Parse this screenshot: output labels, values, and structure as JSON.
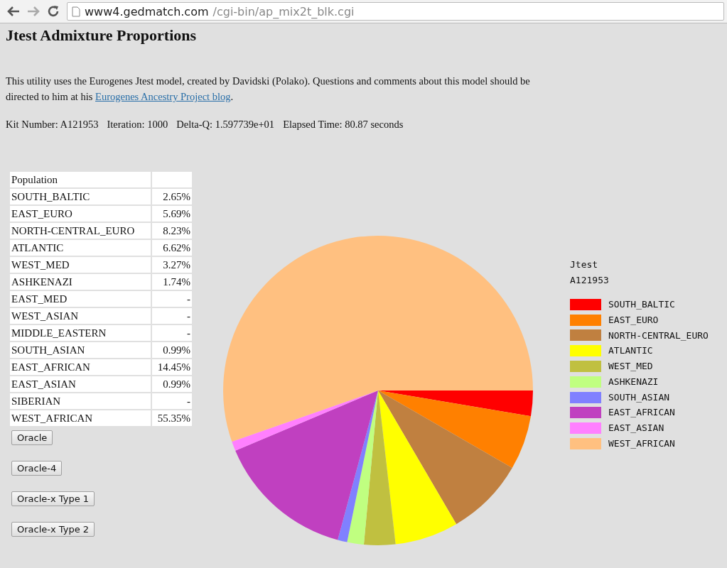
{
  "browser": {
    "url_host": "www4.gedmatch.com",
    "url_path": "/cgi-bin/ap_mix2t_blk.cgi"
  },
  "title": "Jtest Admixture Proportions",
  "intro": {
    "text": "This utility uses the Eurogenes Jtest model, created by Davidski (Polako). Questions and comments about this model should be directed to him at his ",
    "link": "Eurogenes Ancestry Project blog",
    "after": "."
  },
  "run_info": [
    "Kit Number: A121953",
    "Iteration: 1000",
    "Delta-Q: 1.597739e+01",
    "Elapsed Time: 80.87 seconds"
  ],
  "table": {
    "columns": [
      "Population"
    ],
    "rows": [
      {
        "population": "SOUTH_BALTIC",
        "value": "2.65%"
      },
      {
        "population": "EAST_EURO",
        "value": "5.69%"
      },
      {
        "population": "NORTH-CENTRAL_EURO",
        "value": "8.23%"
      },
      {
        "population": "ATLANTIC",
        "value": "6.62%"
      },
      {
        "population": "WEST_MED",
        "value": "3.27%"
      },
      {
        "population": "ASHKENAZI",
        "value": "1.74%"
      },
      {
        "population": "EAST_MED",
        "value": "-"
      },
      {
        "population": "WEST_ASIAN",
        "value": "-"
      },
      {
        "population": "MIDDLE_EASTERN",
        "value": "-"
      },
      {
        "population": "SOUTH_ASIAN",
        "value": "0.99%"
      },
      {
        "population": "EAST_AFRICAN",
        "value": "14.45%"
      },
      {
        "population": "EAST_ASIAN",
        "value": "0.99%"
      },
      {
        "population": "SIBERIAN",
        "value": "-"
      },
      {
        "population": "WEST_AFRICAN",
        "value": "55.35%"
      }
    ]
  },
  "buttons": [
    "Oracle",
    "Oracle-4",
    "Oracle-x Type 1",
    "Oracle-x Type 2"
  ],
  "chart": {
    "chart_data": {
      "type": "pie",
      "title": "Jtest",
      "legend": true,
      "categories": [
        "SOUTH_BALTIC",
        "EAST_EURO",
        "NORTH-CENTRAL_EURO",
        "ATLANTIC",
        "WEST_MED",
        "ASHKENAZI",
        "SOUTH_ASIAN",
        "EAST_AFRICAN",
        "EAST_ASIAN",
        "WEST_AFRICAN"
      ],
      "colors": [
        "#ff0000",
        "#ff8000",
        "#c08040",
        "#ffff00",
        "#c0c040",
        "#c0ff80",
        "#8080ff",
        "#c040c0",
        "#ff80ff",
        "#ffc080"
      ],
      "series": [
        {
          "name": "A121953",
          "values": [
            2.65,
            5.69,
            8.23,
            6.62,
            3.27,
            1.74,
            0.99,
            14.45,
            0.99,
            55.35
          ]
        }
      ]
    }
  }
}
